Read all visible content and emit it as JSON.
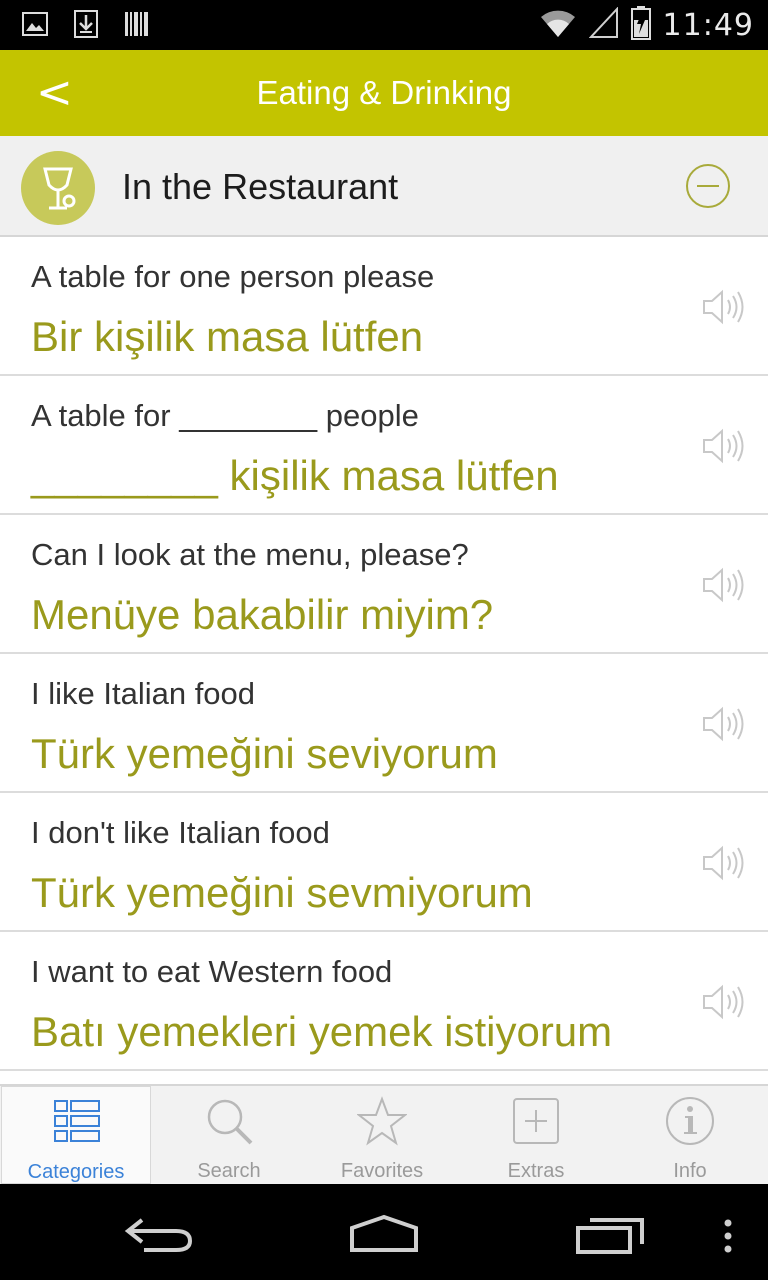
{
  "status_bar": {
    "time": "11:49",
    "icons": [
      "image-icon",
      "download-icon",
      "barcode-icon",
      "wifi-icon",
      "signal-icon",
      "battery-charging-icon"
    ]
  },
  "app_bar": {
    "back_label": "<",
    "title": "Eating & Drinking"
  },
  "section": {
    "title": "In the Restaurant",
    "icon": "wine-glass-icon",
    "collapse_icon": "minus-circle-icon"
  },
  "phrases": [
    {
      "english": "A table for one person please",
      "turkish": "Bir kişilik masa lütfen"
    },
    {
      "english": "A table for ________ people",
      "turkish": "________ kişilik masa lütfen"
    },
    {
      "english": "Can I look at the menu, please?",
      "turkish": "Menüye bakabilir miyim?"
    },
    {
      "english": "I like Italian food",
      "turkish": "Türk yemeğini seviyorum"
    },
    {
      "english": "I don't like Italian food",
      "turkish": "Türk yemeğini sevmiyorum"
    },
    {
      "english": "I want to eat Western food",
      "turkish": "Batı yemekleri yemek istiyorum"
    }
  ],
  "tabs": [
    {
      "label": "Categories",
      "icon": "list-grid-icon",
      "active": true
    },
    {
      "label": "Search",
      "icon": "magnifier-icon",
      "active": false
    },
    {
      "label": "Favorites",
      "icon": "star-icon",
      "active": false
    },
    {
      "label": "Extras",
      "icon": "plus-box-icon",
      "active": false
    },
    {
      "label": "Info",
      "icon": "info-icon",
      "active": false
    }
  ],
  "colors": {
    "accent": "#c3c400",
    "turkish_text": "#9a9a1c",
    "active_tab": "#3b82d8"
  }
}
